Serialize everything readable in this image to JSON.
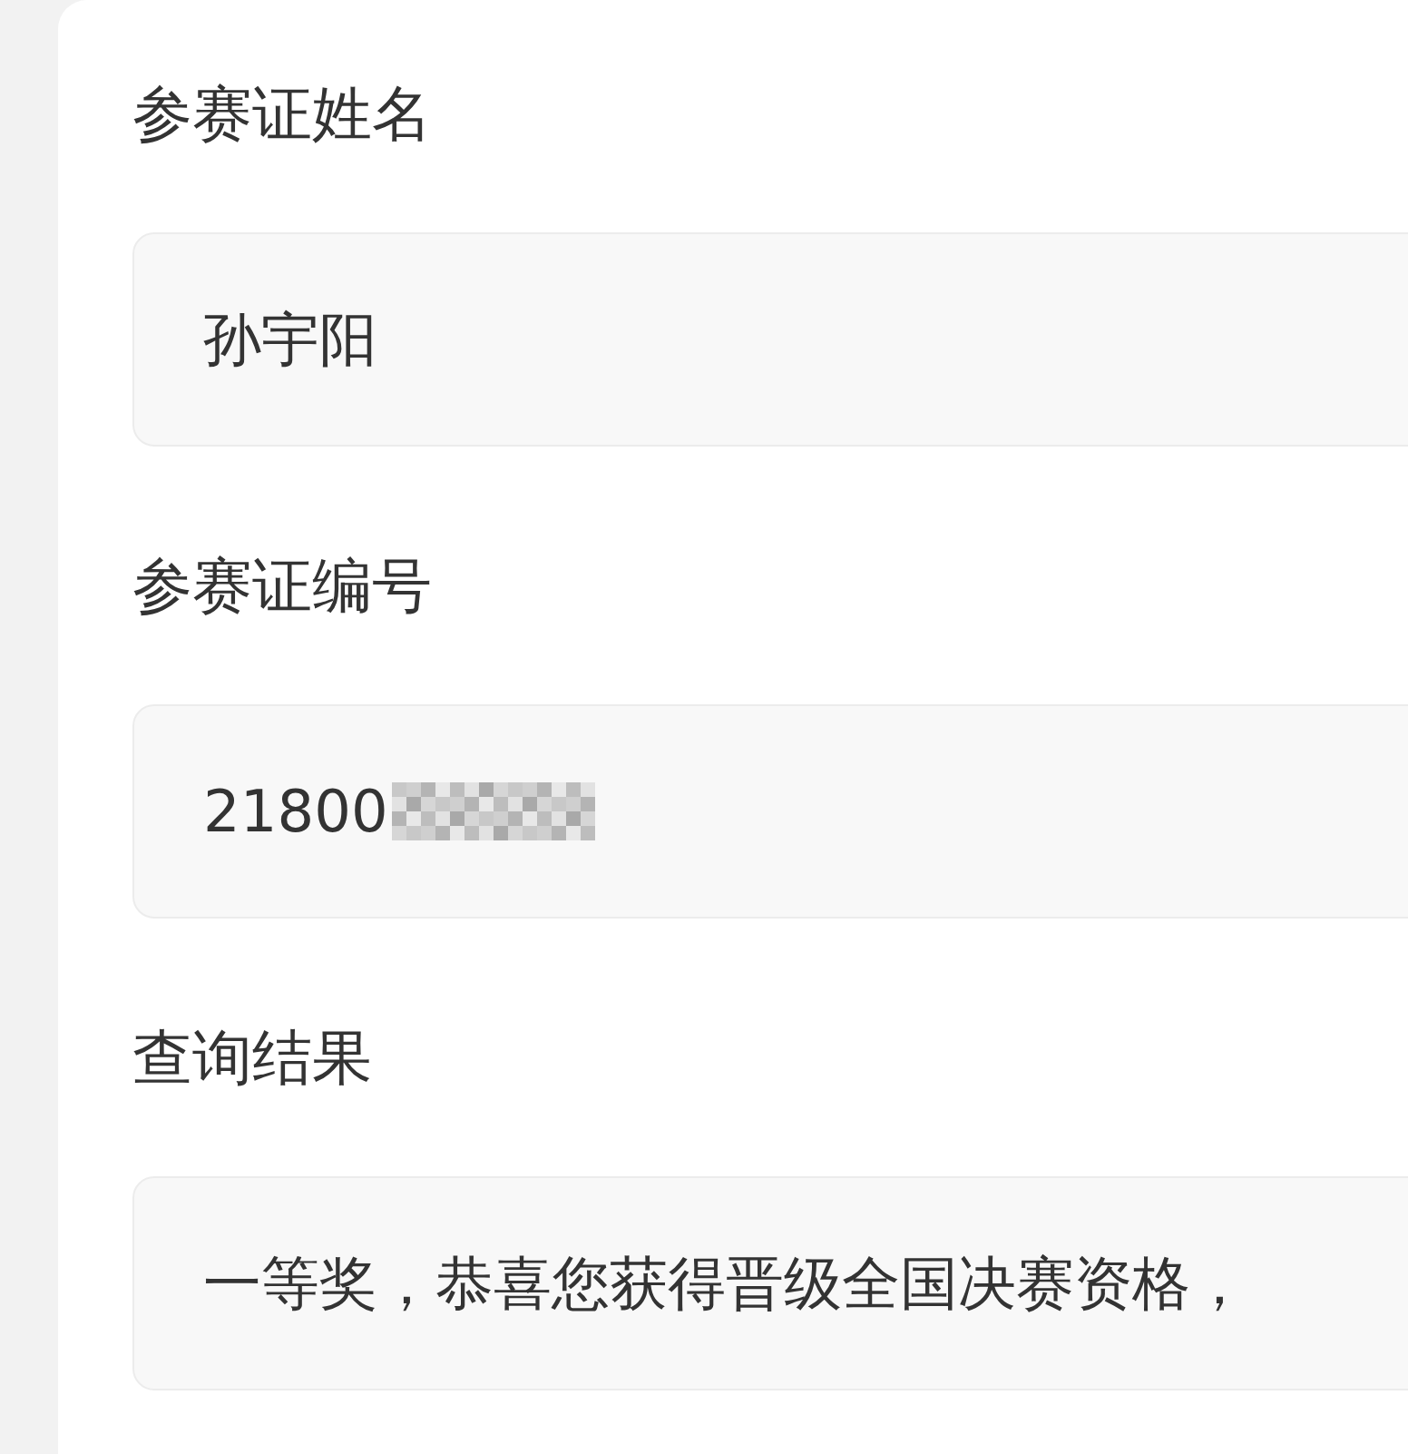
{
  "fields": [
    {
      "label": "参赛证姓名",
      "value": "孙宇阳",
      "redacted": false
    },
    {
      "label": "参赛证编号",
      "value": "21800",
      "redacted": true
    },
    {
      "label": "查询结果",
      "value": "一等奖，恭喜您获得晋级全国决赛资格，",
      "redacted": false
    }
  ]
}
